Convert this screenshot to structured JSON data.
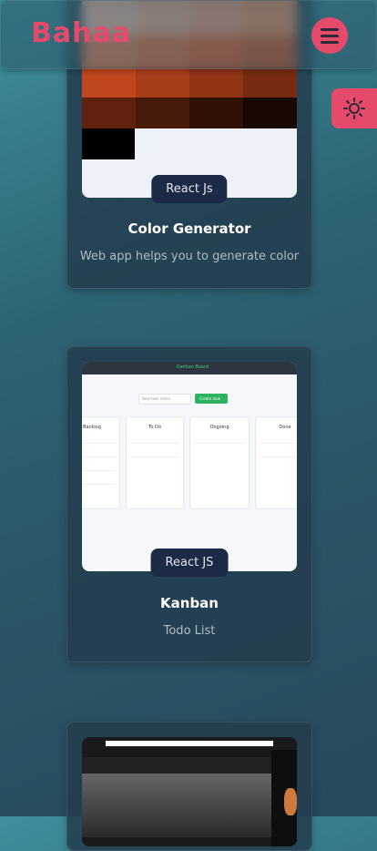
{
  "header": {
    "logo": "Bahaa",
    "menu_icon": "hamburger-icon"
  },
  "theme_toggle": {
    "icon": "sun-icon"
  },
  "projects": [
    {
      "tag": "React Js",
      "title": "Color Generator",
      "description": "Web app helps you to generate color"
    },
    {
      "tag": "React JS",
      "title": "Kanban",
      "description": "Todo List"
    },
    {
      "tag": "",
      "title": "",
      "description": ""
    }
  ],
  "kanban_preview": {
    "app_title": "Kanban Board",
    "input_placeholder": "New task name",
    "create_label": "Create task",
    "columns": [
      "Backlog",
      "To Do",
      "Ongoing",
      "Done"
    ]
  },
  "colors": {
    "accent": "#e64a6a",
    "tag_bg": "#1c2a45"
  }
}
